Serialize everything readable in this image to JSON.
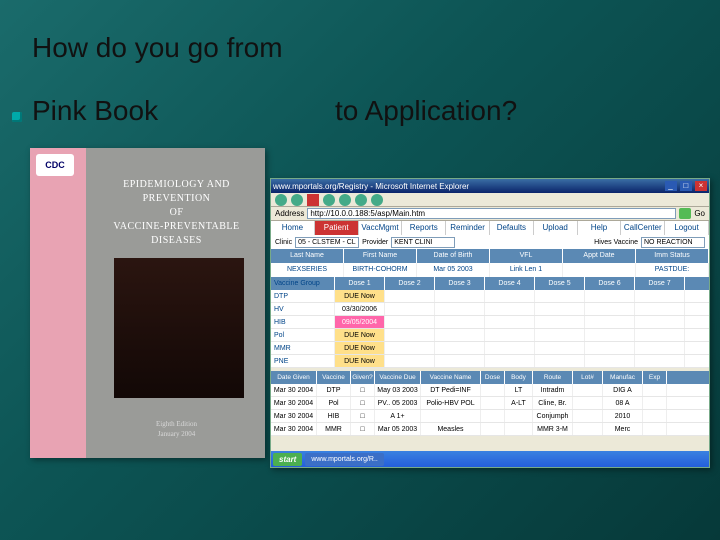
{
  "slide": {
    "title": "How do you go from",
    "left_label": "Pink Book",
    "right_label": "to Application?"
  },
  "book": {
    "logo": "CDC",
    "title_line1": "EPIDEMIOLOGY AND PREVENTION",
    "title_line2": "OF",
    "title_line3": "VACCINE-PREVENTABLE DISEASES",
    "edition_line1": "Eighth Edition",
    "edition_line2": "January 2004"
  },
  "app": {
    "window_title": "www.mportals.org/Registry - Microsoft Internet Explorer",
    "address_label": "Address",
    "url": "http://10.0.0.188:5/asp/Main.htm",
    "go_label": "Go",
    "menu": [
      "Home",
      "Patient",
      "VaccMgmt",
      "Reports",
      "Reminder",
      "Defaults",
      "Upload",
      "Help",
      "CallCenter",
      "Logout"
    ],
    "menu_active_index": 1,
    "clinic_label": "Clinic",
    "clinic_value": "05 - CLSTEM - CL",
    "provider_label": "Provider",
    "provider_value": "KENT CLINI",
    "hives_label": "Hives Vaccine",
    "hives_value": "NO REACTION",
    "columns": [
      "Last Name",
      "First Name",
      "Date of Birth",
      "VFL",
      "Appt Date",
      "Imm Status"
    ],
    "patient_row": [
      "NEXSERIES",
      "BIRTH-COHORM",
      "Mar 05 2003",
      "Link   Len 1",
      "",
      "PASTDUE:"
    ],
    "schedule": {
      "headers": [
        "Vaccine Group",
        "Dose 1",
        "Dose 2",
        "Dose 3",
        "Dose 4",
        "Dose 5",
        "Dose 6",
        "Dose 7"
      ],
      "rows": [
        {
          "group": "DTP",
          "d1": "DUE Now",
          "d1_status": "due"
        },
        {
          "group": "HV",
          "d1": "03/30/2006"
        },
        {
          "group": "HIB",
          "d1": "09/05/2004",
          "d1_status": "overdue"
        },
        {
          "group": "Pol",
          "d1": "DUE Now",
          "d1_status": "due"
        },
        {
          "group": "MMR",
          "d1": "DUE Now",
          "d1_status": "due"
        },
        {
          "group": "PNE",
          "d1": "DUE Now",
          "d1_status": "due"
        }
      ]
    },
    "admin": {
      "headers": [
        "Date Given",
        "Vaccine Group",
        "Given?",
        "Vaccine Due Date",
        "Vaccine Name",
        "Dose No",
        "Body Site",
        "Route",
        "Lot#",
        "Manufac",
        "Exp"
      ],
      "rows": [
        {
          "date": "Mar 30 2004",
          "group": "DTP",
          "chk": "□",
          "due": "May 03 2003",
          "name": "DT Pedi=INF",
          "dose": "",
          "site": "LT",
          "route": "Intradm",
          "lot": "",
          "mfr": "DIG A"
        },
        {
          "date": "Mar 30 2004",
          "group": "Pol",
          "chk": "□",
          "due": "PV.. 05 2003",
          "name": "Polio-HBV POL PV",
          "dose": "",
          "site": "A-LT",
          "route": "Cline, Br.",
          "lot": "",
          "mfr": "08 A"
        },
        {
          "date": "Mar 30 2004",
          "group": "HIB",
          "chk": "□",
          "due": "A 1+",
          "name": "",
          "dose": "",
          "site": "",
          "route": "Conjumph",
          "lot": "",
          "mfr": "2010"
        },
        {
          "date": "Mar 30 2004",
          "group": "MMR",
          "chk": "□",
          "due": "Mar 05 2003",
          "name": "Measles",
          "dose": "",
          "site": "",
          "route": "MMR 3-M",
          "lot": "",
          "mfr": "Merc"
        }
      ]
    },
    "taskbar": {
      "start": "start",
      "task1": "www.mportals.org/R..",
      "tray": ""
    }
  }
}
